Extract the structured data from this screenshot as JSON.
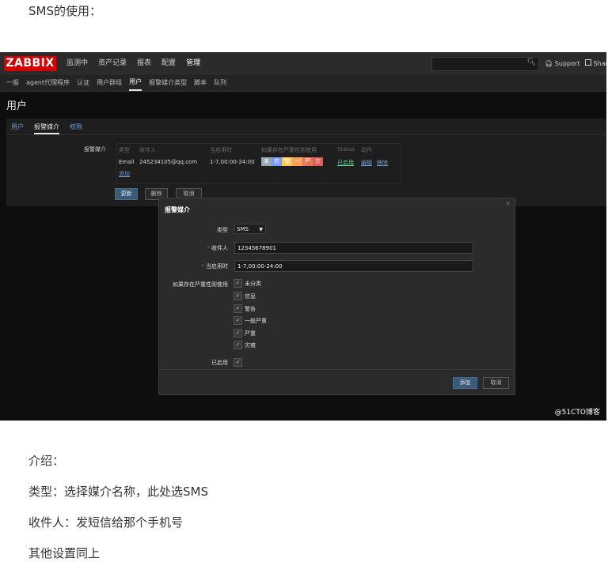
{
  "article": {
    "intro": "SMS的使用：",
    "para1": "介绍：",
    "para2": "类型：选择媒介名称，此处选SMS",
    "para3": "收件人：发短信给那个手机号",
    "para4": "其他设置同上"
  },
  "header": {
    "logo": "ZABBIX",
    "menu": [
      "监测中",
      "资产记录",
      "报表",
      "配置",
      "管理"
    ],
    "search_icon": "search-icon",
    "support": "Support",
    "share": "Share"
  },
  "subnav": {
    "items": [
      "一般",
      "agent代理程序",
      "认证",
      "用户群组",
      "用户",
      "报警媒介类型",
      "脚本",
      "队列"
    ]
  },
  "page": {
    "title": "用户"
  },
  "tabs": [
    "用户",
    "报警媒介",
    "权限"
  ],
  "media": {
    "label": "报警媒介",
    "headers": [
      "类型",
      "收件人",
      "当启用时",
      "如果存在严重性则使用",
      "Status",
      "动作"
    ],
    "row": {
      "type": "Email",
      "recipient": "245234105@qq.com",
      "when_active": "1-7,00:00-24:00",
      "severities": [
        {
          "abbr": "未",
          "color": "#97aab3"
        },
        {
          "abbr": "信",
          "color": "#7499ff"
        },
        {
          "abbr": "警",
          "color": "#ffc859"
        },
        {
          "abbr": "一",
          "color": "#ffa059"
        },
        {
          "abbr": "严",
          "color": "#e97659"
        },
        {
          "abbr": "灾",
          "color": "#e45959"
        }
      ],
      "status": "已启用",
      "edit": "编辑",
      "remove": "移除"
    },
    "add_link": "添加"
  },
  "buttons": {
    "update": "更新",
    "delete": "删除",
    "cancel": "取消"
  },
  "modal": {
    "title": "报警媒介",
    "close": "×",
    "type_label": "类型",
    "type_value": "SMS",
    "recipient_label": "收件人",
    "recipient_value": "12345678901",
    "when_label": "当启用时",
    "when_value": "1-7,00:00-24:00",
    "severity_label": "如果存在严重性则使用",
    "severities": [
      "未分类",
      "信息",
      "警告",
      "一般严重",
      "严重",
      "灾难"
    ],
    "enabled_label": "已启用",
    "add_button": "添加",
    "cancel_button": "取消"
  },
  "watermark": "@51CTO博客"
}
